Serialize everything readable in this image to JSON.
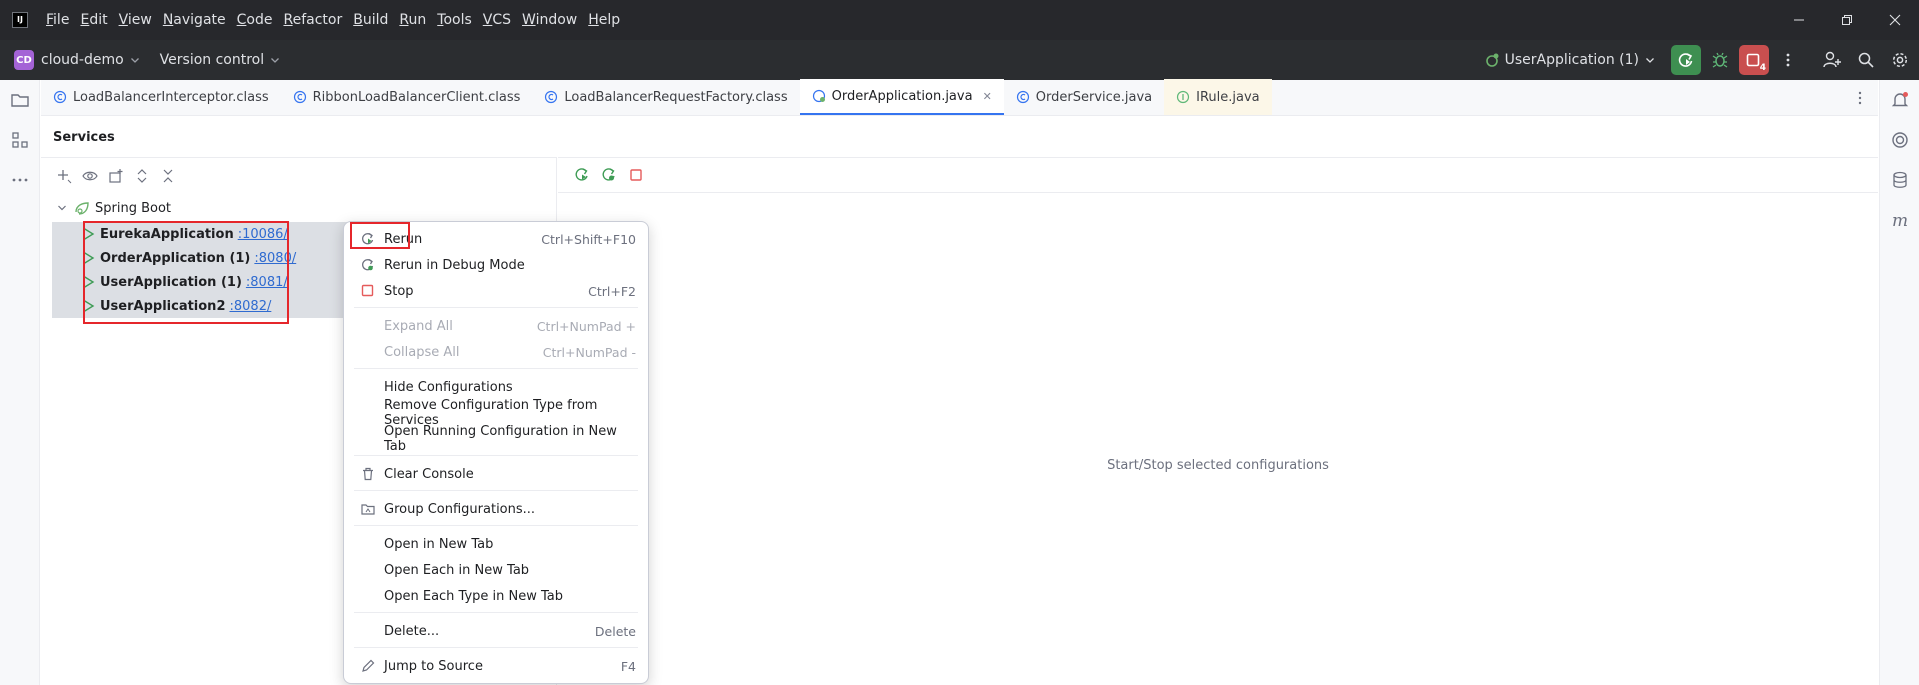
{
  "menubar": {
    "items": [
      "File",
      "Edit",
      "View",
      "Navigate",
      "Code",
      "Refactor",
      "Build",
      "Run",
      "Tools",
      "VCS",
      "Window",
      "Help"
    ]
  },
  "toolbar": {
    "project_initials": "CD",
    "project_name": "cloud-demo",
    "vcs_label": "Version control",
    "run_config": "UserApplication (1)",
    "stop_badge_count": "4"
  },
  "tabs": [
    {
      "label": "LoadBalancerInterceptor.class"
    },
    {
      "label": "RibbonLoadBalancerClient.class"
    },
    {
      "label": "LoadBalancerRequestFactory.class"
    },
    {
      "label": "OrderApplication.java"
    },
    {
      "label": "OrderService.java"
    },
    {
      "label": "IRule.java"
    }
  ],
  "services": {
    "title": "Services",
    "root": "Spring Boot",
    "apps": [
      {
        "name": "EurekaApplication",
        "port": ":10086/"
      },
      {
        "name": "OrderApplication (1)",
        "port": ":8080/"
      },
      {
        "name": "UserApplication (1)",
        "port": ":8081/"
      },
      {
        "name": "UserApplication2",
        "port": ":8082/"
      }
    ],
    "empty_message": "Start/Stop selected configurations"
  },
  "context_menu": {
    "items": [
      {
        "label": "Rerun",
        "shortcut": "Ctrl+Shift+F10"
      },
      {
        "label": "Rerun in Debug Mode",
        "shortcut": ""
      },
      {
        "label": "Stop",
        "shortcut": "Ctrl+F2"
      },
      {
        "label": "Expand All",
        "shortcut": "Ctrl+NumPad +"
      },
      {
        "label": "Collapse All",
        "shortcut": "Ctrl+NumPad -"
      },
      {
        "label": "Hide Configurations",
        "shortcut": ""
      },
      {
        "label": "Remove Configuration Type from Services",
        "shortcut": ""
      },
      {
        "label": "Open Running Configuration in New Tab",
        "shortcut": ""
      },
      {
        "label": "Clear Console",
        "shortcut": ""
      },
      {
        "label": "Group Configurations...",
        "shortcut": ""
      },
      {
        "label": "Open in New Tab",
        "shortcut": ""
      },
      {
        "label": "Open Each in New Tab",
        "shortcut": ""
      },
      {
        "label": "Open Each Type in New Tab",
        "shortcut": ""
      },
      {
        "label": "Delete...",
        "shortcut": "Delete"
      },
      {
        "label": "Jump to Source",
        "shortcut": "F4"
      }
    ]
  },
  "colors": {
    "accent": "#3574f0",
    "highlight": "#e5262b",
    "run_green": "#3e8f51",
    "stop_red": "#c94f4f"
  }
}
